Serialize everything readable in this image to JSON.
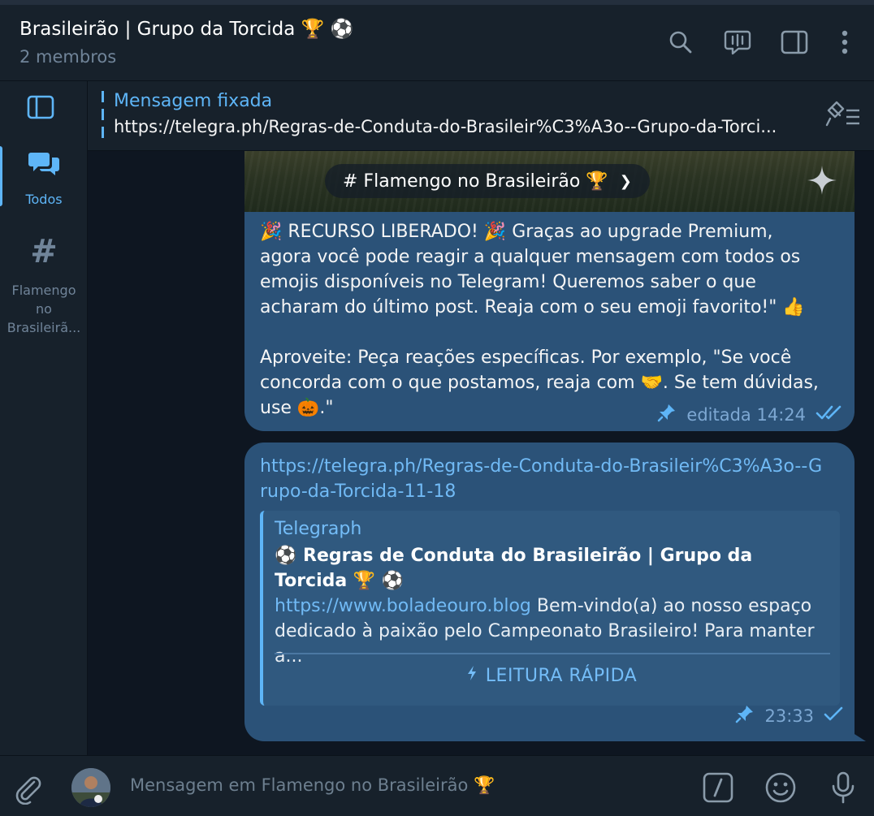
{
  "header": {
    "title": "Brasileirão | Grupo da Torcida 🏆 ⚽",
    "subtitle": "2 membros",
    "icons": [
      "search-icon",
      "video-chat-icon",
      "sidebar-toggle-icon",
      "more-icon"
    ]
  },
  "leftnav": {
    "items": [
      {
        "label": "Todos",
        "icon": "chats-icon",
        "active": true
      },
      {
        "label": "Flamengo no Brasileirã...",
        "icon": "hashtag-icon",
        "active": false
      }
    ]
  },
  "pinned": {
    "title": "Mensagem fixada",
    "text": "https://telegra.ph/Regras-de-Conduta-do-Brasileir%C3%A3o--Grupo-da-Torci..."
  },
  "messages": {
    "first": {
      "channel_tag": "# Flamengo no Brasileirão 🏆",
      "paragraph1": "🎉 RECURSO LIBERADO! 🎉 Graças ao upgrade Premium, agora você pode reagir a qualquer mensagem com todos os emojis disponíveis no Telegram! Queremos saber o que acharam do último post. Reaja com o seu emoji favorito!\" 👍",
      "paragraph2": "Aproveite: Peça reações específicas. Por exemplo, \"Se você concorda com o que postamos, reaja com 🤝. Se tem dúvidas, use 🎃.\"",
      "meta": "editada 14:24"
    },
    "second": {
      "link": "https://telegra.ph/Regras-de-Conduta-do-Brasileir%C3%A3o--Grupo-da-Torcida-11-18",
      "preview": {
        "site": "Telegraph",
        "title": "⚽ Regras de Conduta do Brasileirão | Grupo da Torcida 🏆 ⚽",
        "url": "https://www.boladeouro.blog",
        "description": " Bem-vindo(a) ao nosso espaço dedicado à paixão pelo Campeonato Brasileiro! Para manter a...",
        "instant_view": "LEITURA RÁPIDA"
      },
      "meta": "23:33"
    }
  },
  "composer": {
    "placeholder": "Mensagem em Flamengo no Brasileirão 🏆"
  },
  "colors": {
    "accent": "#5eb5f7",
    "bubble": "#2b5278",
    "background": "#0e1621",
    "panel": "#17212b"
  }
}
